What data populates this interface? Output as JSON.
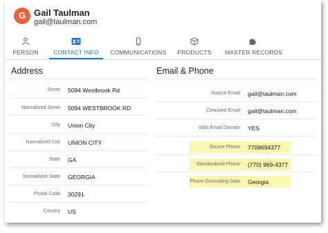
{
  "contact": {
    "initial": "G",
    "name": "Gail Taulman",
    "email": "gail@taulman.com"
  },
  "tabs": [
    {
      "label": "PERSON",
      "icon": "person-icon"
    },
    {
      "label": "CONTACT INFO",
      "icon": "contact-card-icon",
      "active": true
    },
    {
      "label": "COMMUNICATIONS",
      "icon": "phone-icon"
    },
    {
      "label": "PRODUCTS",
      "icon": "box-icon"
    },
    {
      "label": "MASTER RECORDS",
      "icon": "puzzle-icon"
    }
  ],
  "address": {
    "title": "Address",
    "rows": [
      {
        "label": "Street",
        "value": "5094 Westbrook Rd"
      },
      {
        "label": "Normalized Street",
        "value": "5094 WESTBROOK RD"
      },
      {
        "label": "City",
        "value": "Union City"
      },
      {
        "label": "Normalized City",
        "value": "UNION CITY"
      },
      {
        "label": "State",
        "value": "GA"
      },
      {
        "label": "Normalized State",
        "value": "GEORGIA"
      },
      {
        "label": "Postal Code",
        "value": "30291"
      },
      {
        "label": "Country",
        "value": "US"
      }
    ]
  },
  "email_phone": {
    "title": "Email & Phone",
    "rows": [
      {
        "label": "Source Email",
        "value": "gail@taulman.com"
      },
      {
        "label": "Cleansed Email",
        "value": "gail@taulman.com"
      },
      {
        "label": "Valid Email Domain",
        "value": "YES"
      },
      {
        "label": "Source Phone",
        "value": "7709694377",
        "highlight": true
      },
      {
        "label": "Standardized Phone",
        "value": "(770) 969-4377",
        "highlight": true
      },
      {
        "label": "Phone Geocoding Data",
        "value": "Georgia",
        "highlight": true
      }
    ]
  },
  "colors": {
    "accent": "#1e73c4",
    "avatar": "#e8633a",
    "highlight": "#fbf6b0"
  }
}
